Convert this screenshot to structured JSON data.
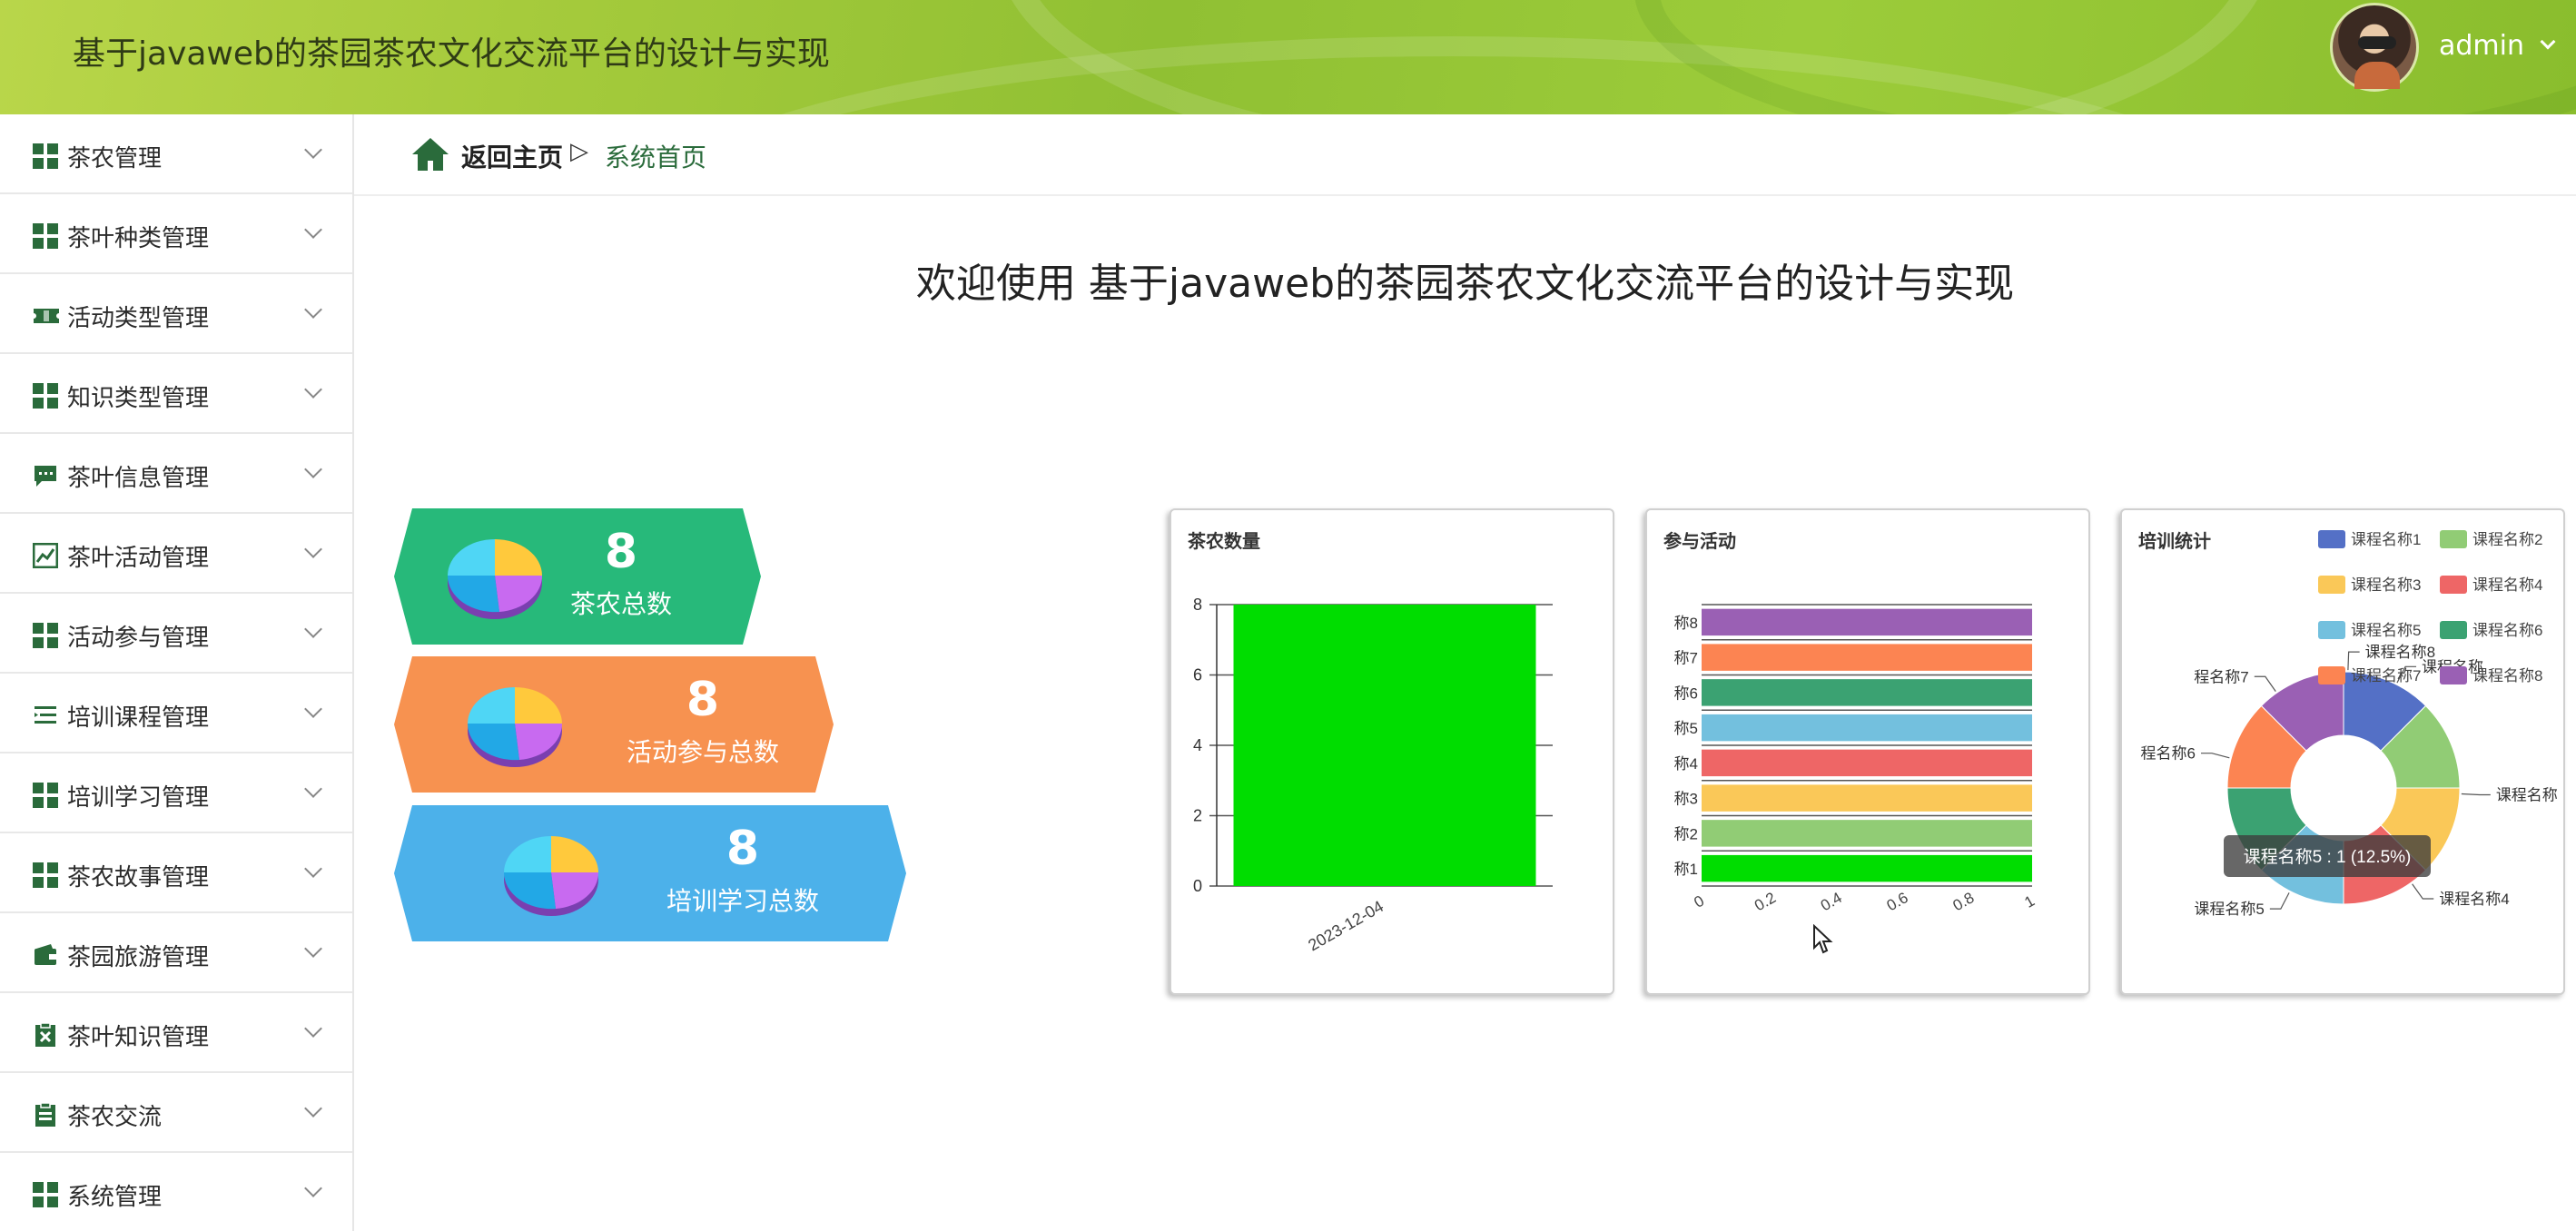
{
  "header": {
    "title": "基于javaweb的茶园茶农文化交流平台的设计与实现",
    "username": "admin"
  },
  "sidebar": {
    "items": [
      {
        "label": "茶农管理",
        "icon": "grid-icon"
      },
      {
        "label": "茶叶种类管理",
        "icon": "grid-icon"
      },
      {
        "label": "活动类型管理",
        "icon": "ticket-icon"
      },
      {
        "label": "知识类型管理",
        "icon": "grid-icon"
      },
      {
        "label": "茶叶信息管理",
        "icon": "message-icon"
      },
      {
        "label": "茶叶活动管理",
        "icon": "trend-chart-icon"
      },
      {
        "label": "活动参与管理",
        "icon": "grid-icon"
      },
      {
        "label": "培训课程管理",
        "icon": "list-icon"
      },
      {
        "label": "培训学习管理",
        "icon": "grid-icon"
      },
      {
        "label": "茶农故事管理",
        "icon": "grid-icon"
      },
      {
        "label": "茶园旅游管理",
        "icon": "wallet-icon"
      },
      {
        "label": "茶叶知识管理",
        "icon": "clipboard-x-icon"
      },
      {
        "label": "茶农交流",
        "icon": "clipboard-icon"
      },
      {
        "label": "系统管理",
        "icon": "grid-icon"
      }
    ]
  },
  "breadcrumb": {
    "home": "返回主页",
    "separator": "▷",
    "current": "系统首页"
  },
  "welcome": "欢迎使用 基于javaweb的茶园茶农文化交流平台的设计与实现",
  "stats": [
    {
      "value": "8",
      "label": "茶农总数",
      "color": "#27b97a"
    },
    {
      "value": "8",
      "label": "活动参与总数",
      "color": "#f79250"
    },
    {
      "value": "8",
      "label": "培训学习总数",
      "color": "#4cb1ea"
    }
  ],
  "chart_data": [
    {
      "type": "bar",
      "title": "茶农数量",
      "categories": [
        "2023-12-04"
      ],
      "values": [
        8
      ],
      "ylim": [
        0,
        8
      ],
      "yticks": [
        0,
        2,
        4,
        6,
        8
      ],
      "color": "#00dd00"
    },
    {
      "type": "bar",
      "orientation": "horizontal",
      "title": "参与活动",
      "categories": [
        "称1",
        "称2",
        "称3",
        "称4",
        "称5",
        "称6",
        "称7",
        "称8"
      ],
      "values": [
        1,
        1,
        1,
        1,
        1,
        1,
        1,
        1
      ],
      "xticks": [
        "0",
        "0.2",
        "0.4",
        "0.6",
        "0.8",
        "1"
      ],
      "xlim": [
        0,
        1
      ],
      "colors": [
        "#00dd00",
        "#91cc75",
        "#fac858",
        "#ee6666",
        "#73c0de",
        "#3ba272",
        "#fc8452",
        "#9a60b4"
      ]
    },
    {
      "type": "pie",
      "title": "培训统计",
      "donut": true,
      "categories": [
        "课程名称1",
        "课程名称2",
        "课程名称3",
        "课程名称4",
        "课程名称5",
        "课程名称6",
        "课程名称7",
        "课程名称8"
      ],
      "outer_labels": [
        "课程名称",
        "课程名称",
        "课程名称4",
        "课程名称5",
        "程名称6",
        "程名称7",
        "课程名称8"
      ],
      "values": [
        1,
        1,
        1,
        1,
        1,
        1,
        1,
        1
      ],
      "colors": [
        "#5470c6",
        "#91cc75",
        "#fac858",
        "#ee6666",
        "#73c0de",
        "#3ba272",
        "#fc8452",
        "#9a60b4"
      ],
      "legend_position": "top-right",
      "tooltip": "课程名称5 : 1 (12.5%)"
    }
  ]
}
